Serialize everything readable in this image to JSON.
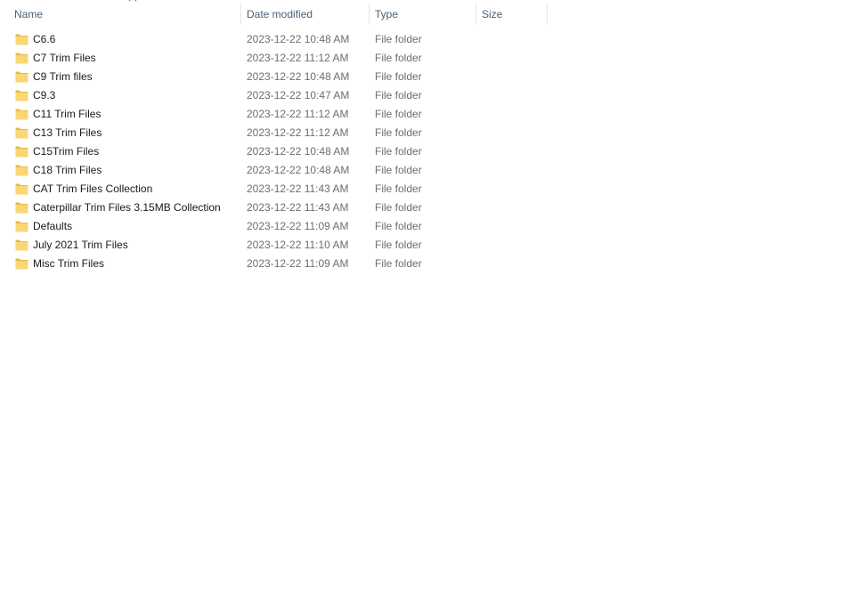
{
  "columns": {
    "name": "Name",
    "date": "Date modified",
    "type": "Type",
    "size": "Size"
  },
  "colors": {
    "folder_fill": "#f8d775",
    "folder_tab": "#e9b949",
    "header_text": "#4c607a",
    "secondary_text": "#6d6d6d"
  },
  "icons": {
    "sort": "sort-ascending-chevron-icon",
    "item": "folder-icon"
  },
  "items": [
    {
      "name": "C6.6",
      "date": "2023-12-22 10:48 AM",
      "type": "File folder",
      "size": ""
    },
    {
      "name": "C7 Trim Files",
      "date": "2023-12-22 11:12 AM",
      "type": "File folder",
      "size": ""
    },
    {
      "name": "C9 Trim files",
      "date": "2023-12-22 10:48 AM",
      "type": "File folder",
      "size": ""
    },
    {
      "name": "C9.3",
      "date": "2023-12-22 10:47 AM",
      "type": "File folder",
      "size": ""
    },
    {
      "name": "C11 Trim Files",
      "date": "2023-12-22 11:12 AM",
      "type": "File folder",
      "size": ""
    },
    {
      "name": "C13 Trim Files",
      "date": "2023-12-22 11:12 AM",
      "type": "File folder",
      "size": ""
    },
    {
      "name": "C15Trim Files",
      "date": "2023-12-22 10:48 AM",
      "type": "File folder",
      "size": ""
    },
    {
      "name": "C18 Trim Files",
      "date": "2023-12-22 10:48 AM",
      "type": "File folder",
      "size": ""
    },
    {
      "name": "CAT Trim Files Collection",
      "date": "2023-12-22 11:43 AM",
      "type": "File folder",
      "size": ""
    },
    {
      "name": "Caterpillar Trim Files 3.15MB Collection",
      "date": "2023-12-22 11:43 AM",
      "type": "File folder",
      "size": ""
    },
    {
      "name": "Defaults",
      "date": "2023-12-22 11:09 AM",
      "type": "File folder",
      "size": ""
    },
    {
      "name": "July 2021 Trim Files",
      "date": "2023-12-22 11:10 AM",
      "type": "File folder",
      "size": ""
    },
    {
      "name": "Misc Trim Files",
      "date": "2023-12-22 11:09 AM",
      "type": "File folder",
      "size": ""
    }
  ]
}
